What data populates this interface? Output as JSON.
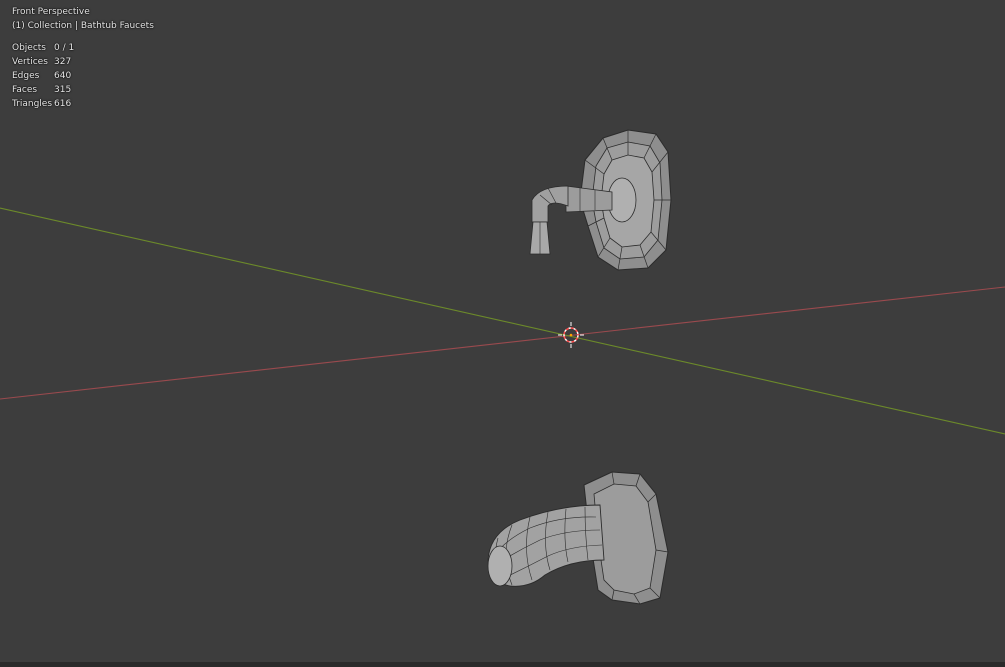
{
  "viewport": {
    "view_name": "Front Perspective",
    "collection_label": "(1) Collection | Bathtub Faucets"
  },
  "stats": [
    {
      "label": "Objects",
      "value": "0 / 1"
    },
    {
      "label": "Vertices",
      "value": "327"
    },
    {
      "label": "Edges",
      "value": "640"
    },
    {
      "label": "Faces",
      "value": "315"
    },
    {
      "label": "Triangles",
      "value": "616"
    }
  ],
  "colors": {
    "background": "#3d3d3d",
    "x_axis": "#9a4a4e",
    "y_axis": "#6c8a2a",
    "mesh_fill": "#9a9a9a",
    "mesh_wire": "#2b2b2b",
    "cursor_outer": "#ffffff",
    "cursor_inner": "#ff4d4d"
  },
  "objects": [
    "faucet-handle-mesh",
    "tub-spout-mesh"
  ]
}
